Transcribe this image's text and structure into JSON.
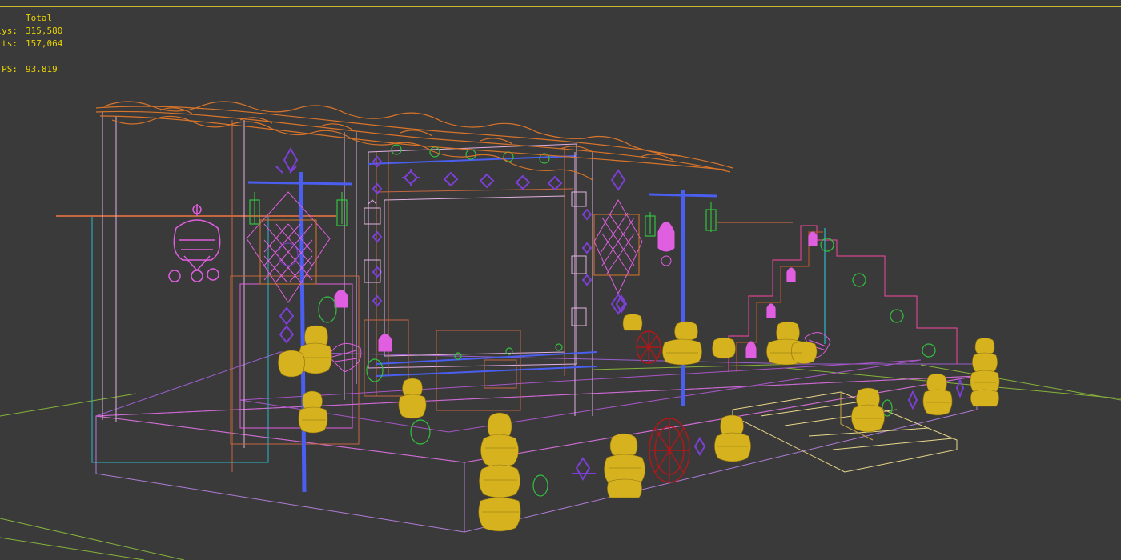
{
  "stats": {
    "header": "Total",
    "polys_label": "olys:",
    "polys_value": "315,580",
    "verts_label": "erts:",
    "verts_value": "157,064",
    "fps_label": "PS:",
    "fps_value": "93.819"
  },
  "colors": {
    "background": "#3a3a3a",
    "text": "#e8d200",
    "roof": "#d8742a",
    "pillar": "#d6a6d6",
    "blue_pole": "#4a5ef0",
    "pots": "#d6b21f",
    "violet": "#7d3fd8",
    "magenta": "#e05ee0",
    "green": "#32c040",
    "red": "#b01818",
    "brown": "#b0552a",
    "grid": "#9ad23a",
    "cyan": "#2ab8c8"
  }
}
